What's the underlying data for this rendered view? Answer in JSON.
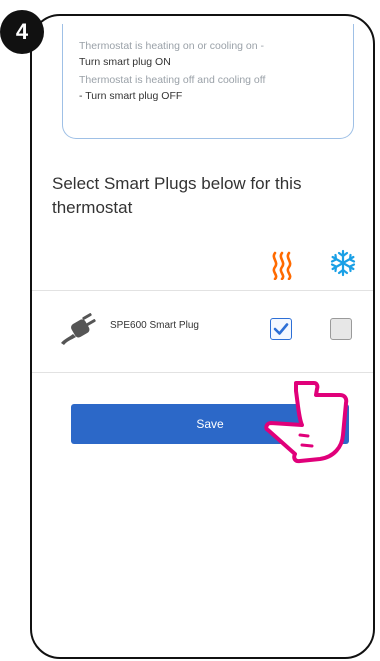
{
  "step": {
    "number": "4"
  },
  "info": {
    "line1_muted": "Thermostat is heating on or cooling on -",
    "line1_strong": "Turn smart plug ON",
    "line2_muted": "Thermostat is heating off and cooling off",
    "line2_strong": "- Turn smart plug OFF"
  },
  "instruction": "Select Smart Plugs below for this thermostat",
  "columns": {
    "heating_icon": "heating-waves-icon",
    "cooling_icon": "snowflake-icon"
  },
  "plugs": [
    {
      "name": "SPE600 Smart Plug",
      "icon": "plug-icon",
      "heating_checked": true,
      "cooling_checked": false
    }
  ],
  "save_label": "Save",
  "colors": {
    "accent": "#2c68c8",
    "heat": "#ff6a00",
    "cool": "#1aa0e6",
    "pointer": "#e0007a",
    "box_border": "#9fc0e6"
  }
}
